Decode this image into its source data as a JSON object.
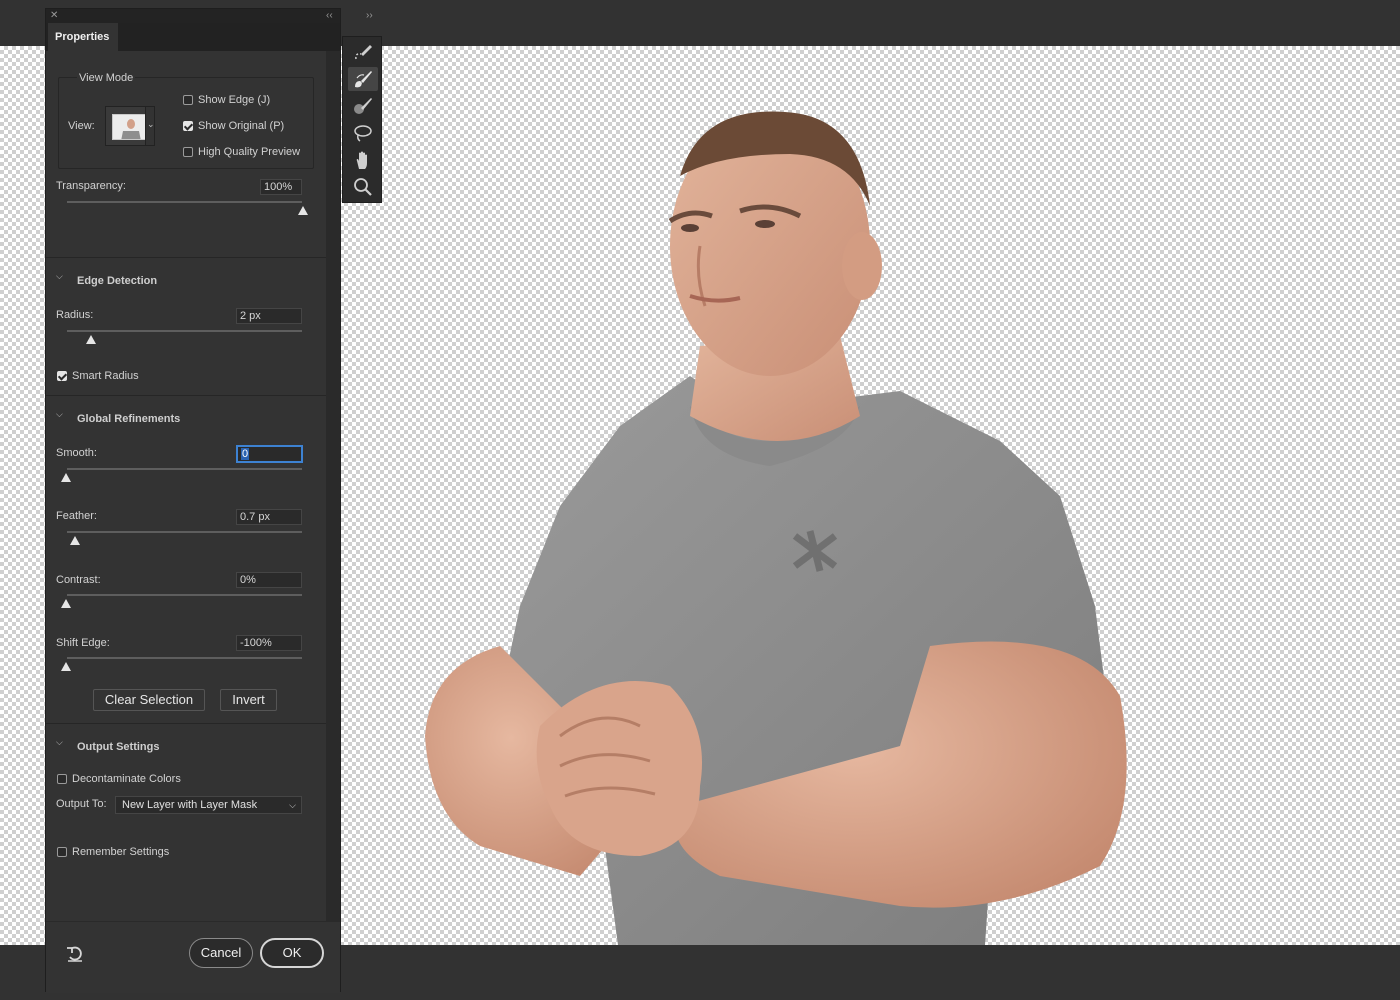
{
  "panel": {
    "tab": "Properties",
    "view_mode": {
      "title": "View Mode",
      "view_label": "View:",
      "show_edge": {
        "label": "Show Edge (J)",
        "checked": false
      },
      "show_original": {
        "label": "Show Original (P)",
        "checked": true
      },
      "high_quality": {
        "label": "High Quality Preview",
        "checked": false
      }
    },
    "transparency": {
      "label": "Transparency:",
      "value": "100%",
      "level": 1.0
    },
    "edge_detection": {
      "title": "Edge Detection",
      "radius": {
        "label": "Radius:",
        "value": "2 px",
        "level": 0.1
      },
      "smart_radius": {
        "label": "Smart Radius",
        "checked": true
      }
    },
    "global_refinements": {
      "title": "Global Refinements",
      "smooth": {
        "label": "Smooth:",
        "value": "0",
        "level": 0.0
      },
      "feather": {
        "label": "Feather:",
        "value": "0.7 px",
        "level": 0.04
      },
      "contrast": {
        "label": "Contrast:",
        "value": "0%",
        "level": 0.0
      },
      "shift_edge": {
        "label": "Shift Edge:",
        "value": "-100%",
        "level": 0.0
      },
      "clear_selection": "Clear Selection",
      "invert": "Invert"
    },
    "output_settings": {
      "title": "Output Settings",
      "decontaminate": {
        "label": "Decontaminate Colors",
        "checked": false
      },
      "output_to_label": "Output To:",
      "output_to_value": "New Layer with Layer Mask"
    },
    "remember": {
      "label": "Remember Settings",
      "checked": false
    },
    "footer": {
      "cancel": "Cancel",
      "ok": "OK"
    },
    "strip_icons": [
      "close-icon",
      "collapse-icon",
      "expand-icon"
    ]
  },
  "tools": [
    {
      "name": "quick-selection-tool-icon",
      "active": false
    },
    {
      "name": "refine-edge-brush-tool-icon",
      "active": true
    },
    {
      "name": "brush-tool-icon",
      "active": false
    },
    {
      "name": "lasso-tool-icon",
      "active": false
    },
    {
      "name": "hand-tool-icon",
      "active": false
    },
    {
      "name": "zoom-tool-icon",
      "active": false
    }
  ],
  "colors": {
    "panel_bg": "#333333",
    "chrome_bg": "#323232",
    "focus_blue": "#3d82d2",
    "shirt_gray": "#8e8e8e",
    "skin": "#d9a98f"
  }
}
